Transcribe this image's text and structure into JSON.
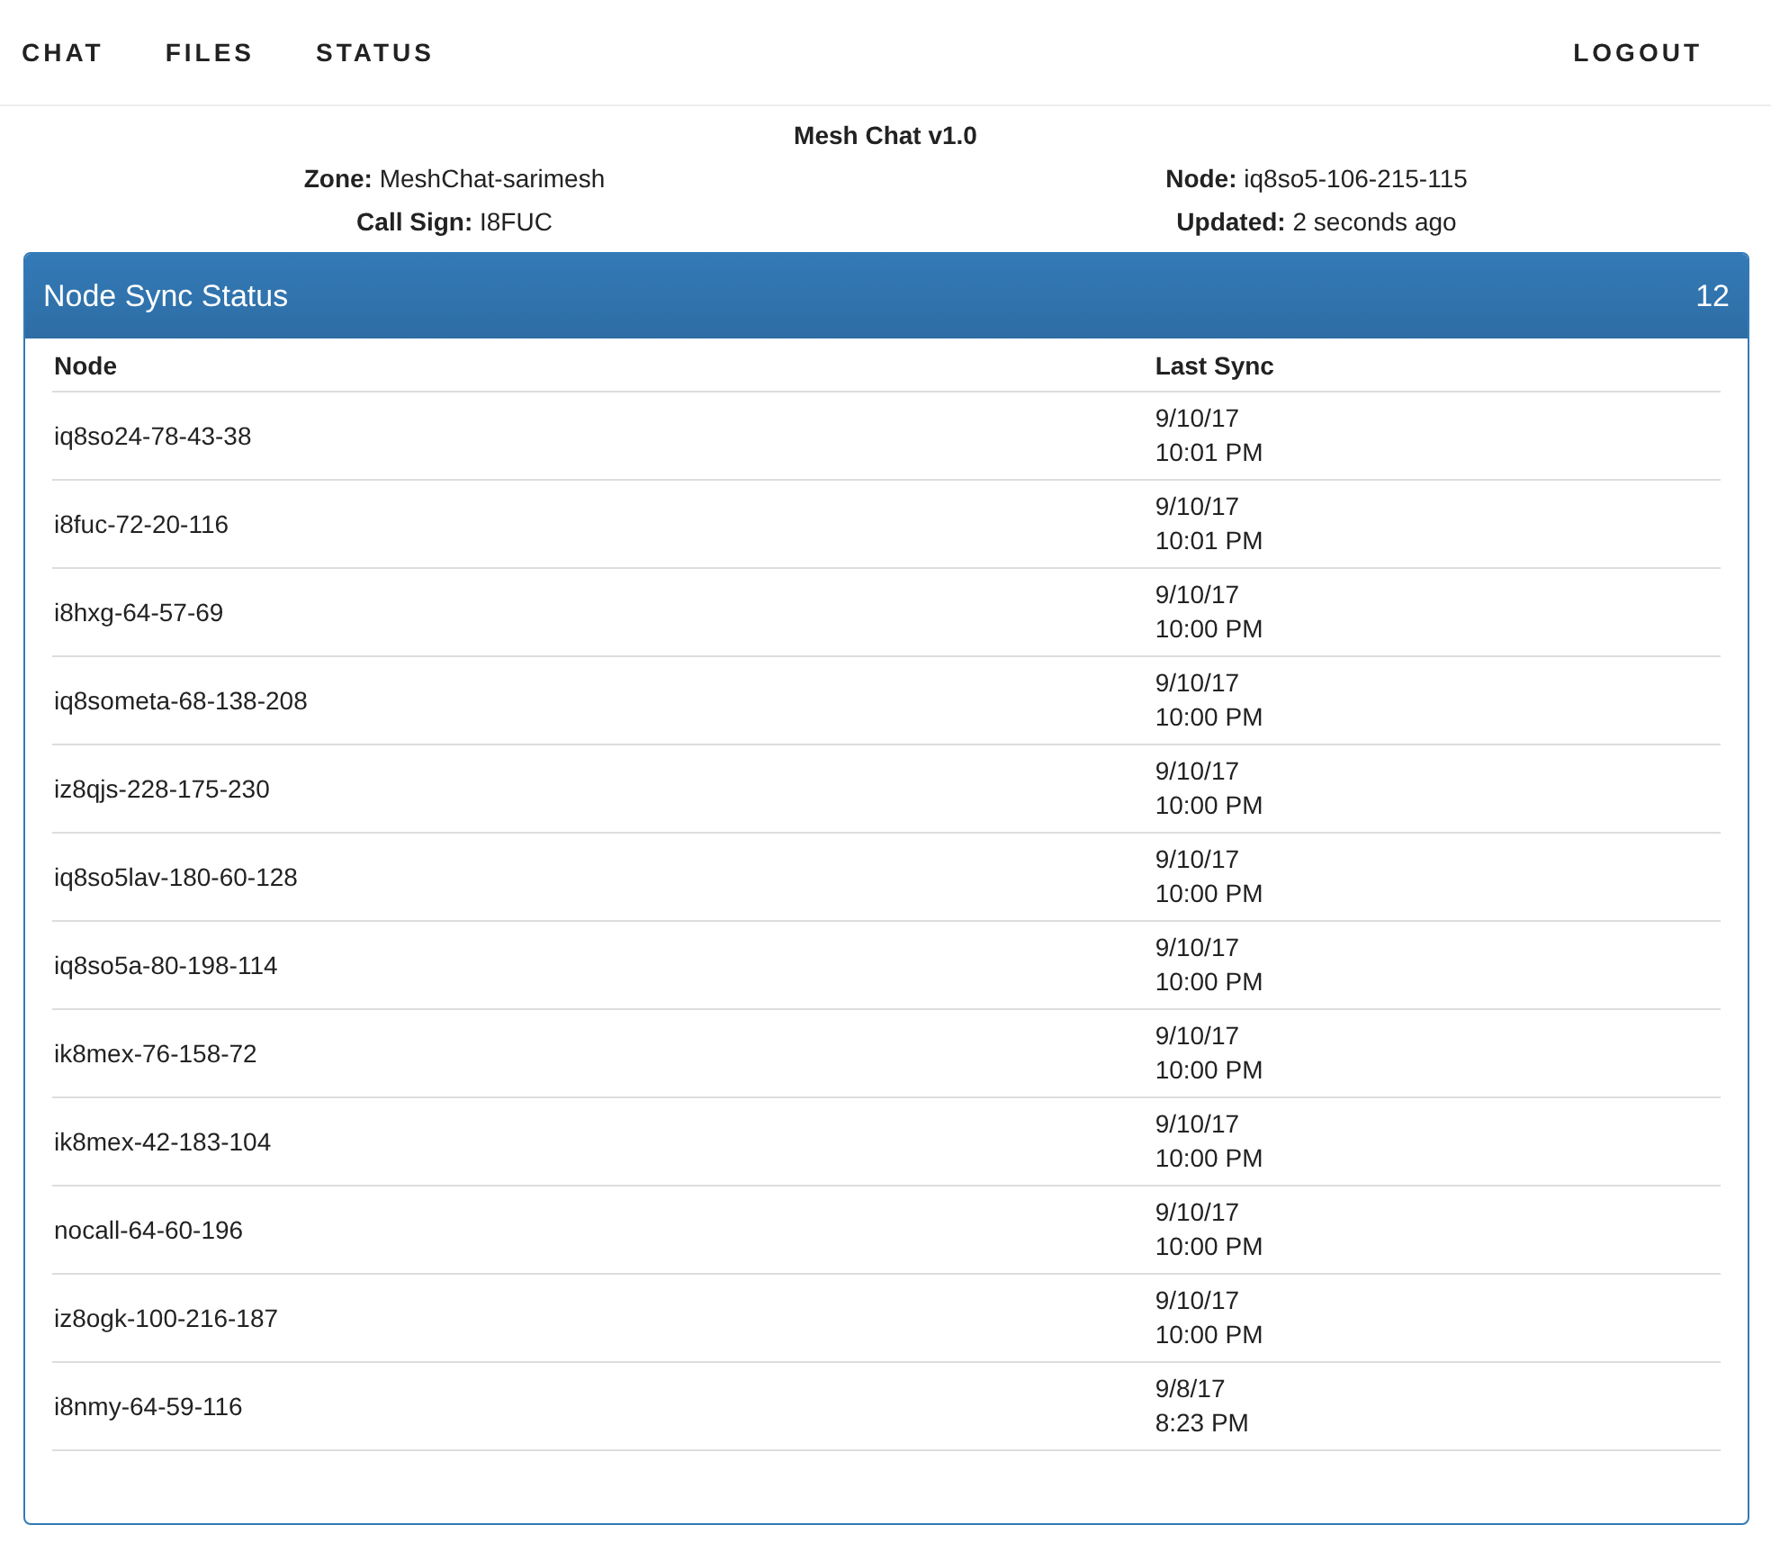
{
  "nav": {
    "links": [
      {
        "label": "CHAT"
      },
      {
        "label": "FILES"
      },
      {
        "label": "STATUS"
      }
    ],
    "logout": "LOGOUT"
  },
  "info": {
    "title": "Mesh Chat v1.0",
    "fields": [
      {
        "label": "Zone:",
        "value": "MeshChat-sarimesh"
      },
      {
        "label": "Node:",
        "value": "iq8so5-106-215-115"
      },
      {
        "label": "Call Sign:",
        "value": "I8FUC"
      },
      {
        "label": "Updated:",
        "value": "2 seconds ago"
      }
    ]
  },
  "panel": {
    "title": "Node Sync Status",
    "count": "12",
    "table": {
      "columns": [
        "Node",
        "Last Sync"
      ],
      "rows": [
        {
          "node": "iq8so24-78-43-38",
          "date": "9/10/17",
          "time": "10:01 PM"
        },
        {
          "node": "i8fuc-72-20-116",
          "date": "9/10/17",
          "time": "10:01 PM"
        },
        {
          "node": "i8hxg-64-57-69",
          "date": "9/10/17",
          "time": "10:00 PM"
        },
        {
          "node": "iq8someta-68-138-208",
          "date": "9/10/17",
          "time": "10:00 PM"
        },
        {
          "node": "iz8qjs-228-175-230",
          "date": "9/10/17",
          "time": "10:00 PM"
        },
        {
          "node": "iq8so5lav-180-60-128",
          "date": "9/10/17",
          "time": "10:00 PM"
        },
        {
          "node": "iq8so5a-80-198-114",
          "date": "9/10/17",
          "time": "10:00 PM"
        },
        {
          "node": "ik8mex-76-158-72",
          "date": "9/10/17",
          "time": "10:00 PM"
        },
        {
          "node": "ik8mex-42-183-104",
          "date": "9/10/17",
          "time": "10:00 PM"
        },
        {
          "node": "nocall-64-60-196",
          "date": "9/10/17",
          "time": "10:00 PM"
        },
        {
          "node": "iz8ogk-100-216-187",
          "date": "9/10/17",
          "time": "10:00 PM"
        },
        {
          "node": "i8nmy-64-59-116",
          "date": "9/8/17",
          "time": "8:23 PM"
        }
      ]
    }
  }
}
